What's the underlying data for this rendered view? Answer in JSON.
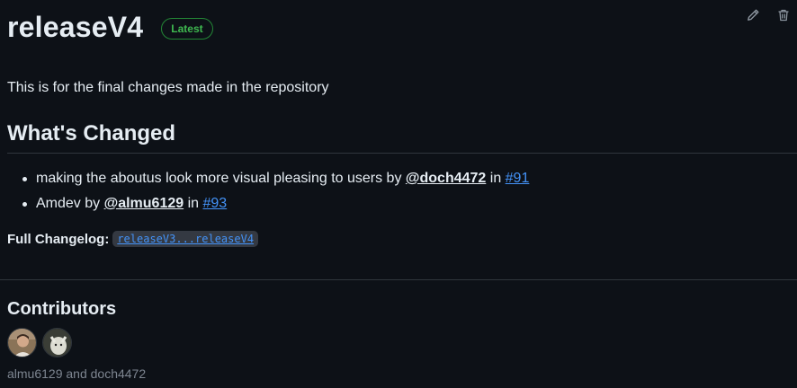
{
  "release": {
    "title": "releaseV4",
    "badge": "Latest",
    "description": "This is for the final changes made in the repository"
  },
  "actions": {
    "edit_icon": "pencil-icon",
    "delete_icon": "trash-icon"
  },
  "whats_changed": {
    "heading": "What's Changed",
    "items": [
      {
        "text": "making the aboutus look more visual pleasing to users by ",
        "author": "@doch4472",
        "in": " in ",
        "pr": "#91"
      },
      {
        "text": "Amdev by ",
        "author": "@almu6129",
        "in": " in ",
        "pr": "#93"
      }
    ]
  },
  "changelog": {
    "label": "Full Changelog:",
    "link": "releaseV3...releaseV4"
  },
  "contributors": {
    "heading": "Contributors",
    "avatars": [
      "almu6129",
      "doch4472"
    ],
    "summary": "almu6129 and doch4472"
  },
  "colors": {
    "background": "#0d1117",
    "text": "#e6edf3",
    "link": "#4493f8",
    "badge": "#3fb950",
    "muted": "#7d8590"
  }
}
